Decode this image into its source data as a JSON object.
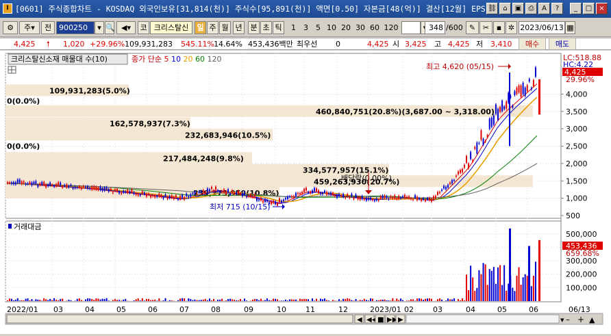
{
  "window": {
    "title": "[0601] 주식종합차트 - KOSDAQ 외국인보유[31,814(천)] 주식수[95,891(천)] 액면[0.50] 자본금[48(억)] 결산[12월] EPS[16",
    "app_icon": "chart-app-icon",
    "buttons": [
      "?",
      "?",
      "?",
      "?",
      "?",
      "?",
      "_",
      "□",
      "×"
    ]
  },
  "toolbar": {
    "period": "주",
    "jeon": "전",
    "code": "900250",
    "kind": "코",
    "stock_name": "크리스탈신",
    "intervals": [
      "일",
      "주",
      "월",
      "년",
      "분",
      "초",
      "틱"
    ],
    "active_interval": "일",
    "minute_options": [
      "1",
      "3",
      "5",
      "10",
      "20",
      "30",
      "60",
      "120"
    ],
    "count": "348",
    "count_total": "/600",
    "date": "2023/06/13"
  },
  "price_bar": {
    "price": "4,425",
    "change": "1,020",
    "change_pct": "+29.96%",
    "volume": "109,931,283",
    "vol_ratio": "545.11%",
    "turnover": "14.64%",
    "amount": "453,436백만",
    "best_bid_label": "최우선",
    "best_bid_value": "0",
    "current": "4,425",
    "open_label": "시",
    "open": "3,425",
    "high_label": "고",
    "high": "4,425",
    "low_label": "저",
    "low": "3,410",
    "buy": "매수",
    "sell": "매도"
  },
  "price_panel": {
    "legend_title": "크리스탈신소재 매물대 수(10)",
    "ma_label": "종가 단순",
    "ma_periods": [
      "5",
      "10",
      "20",
      "60",
      "120"
    ],
    "ma_colors": [
      "#e00000",
      "#0000d0",
      "#e8a000",
      "#008000",
      "#606060"
    ],
    "lc_label": "LC:518.88",
    "hc_label": "HC:4.22",
    "current_tag": "4,425",
    "current_pct": "29.96%",
    "high_note": "최고 4,620 (05/15)",
    "low_note": "최저 715 (10/15)",
    "split_note": "배당락(0.00%)",
    "y_ticks": [
      "4,000",
      "3,500",
      "3,000",
      "2,500",
      "2,000",
      "1,500",
      "1,000",
      "500"
    ],
    "volume_profile": [
      {
        "label": "109,931,283(5.0%)",
        "price": 4100
      },
      {
        "label": "0(0.0%)",
        "price": 3800
      },
      {
        "label": "460,840,751(20.8%)(3,687.00 ~ 3,318.00)",
        "price": 3500
      },
      {
        "label": "162,578,937(7.3%)",
        "price": 3150
      },
      {
        "label": "232,683,946(10.5%)",
        "price": 2820
      },
      {
        "label": "0(0.0%)",
        "price": 2500
      },
      {
        "label": "217,484,248(9.8%)",
        "price": 2150
      },
      {
        "label": "334,577,957(15.1%)",
        "price": 1810
      },
      {
        "label": "459,263,930(20.7%)",
        "price": 1480
      },
      {
        "label": "239,273,959(10.8%)",
        "price": 1150
      }
    ]
  },
  "volume_panel": {
    "title": "거래대금",
    "current_tag": "453,436",
    "current_pct": "659.68%",
    "y_ticks": [
      "500,000",
      "400,000",
      "300,000",
      "200,000",
      "100,000"
    ]
  },
  "x_axis": {
    "labels": [
      "2022/01",
      "03",
      "04",
      "05",
      "06",
      "07",
      "08",
      "09",
      "10",
      "11",
      "12",
      "2023/01",
      "02",
      "03",
      "04",
      "05",
      "06",
      "06/13"
    ]
  },
  "chart_data": {
    "type": "line",
    "x": [
      "2022/01",
      "2022/03",
      "2022/04",
      "2022/05",
      "2022/06",
      "2022/07",
      "2022/08",
      "2022/09",
      "2022/10",
      "2022/11",
      "2022/12",
      "2023/01",
      "2023/02",
      "2023/03",
      "2023/04",
      "2023/05",
      "2023/06"
    ],
    "series": [
      {
        "name": "종가",
        "values": [
          1430,
          1340,
          1280,
          1180,
          1080,
          960,
          1230,
          1060,
          820,
          1210,
          1050,
          960,
          1000,
          930,
          1900,
          3400,
          4425
        ]
      }
    ],
    "ylim": [
      500,
      4620
    ]
  }
}
